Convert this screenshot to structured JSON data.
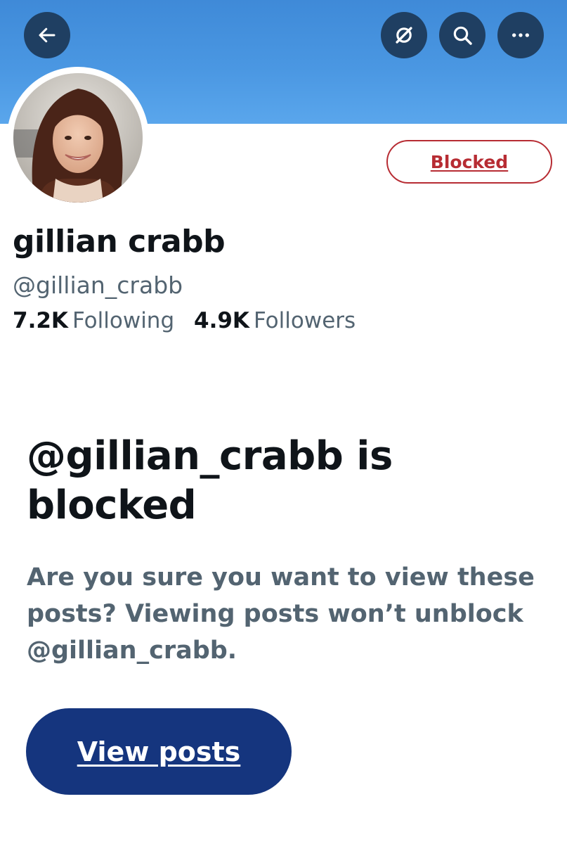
{
  "icons": {
    "back": "arrow-left-icon",
    "grok": "slashed-circle-icon",
    "search": "search-icon",
    "more": "more-horizontal-icon"
  },
  "colors": {
    "banner": "#4a97e2",
    "top_button": "#1f3f62",
    "blocked": "#b72c33",
    "primary_button": "#15357e",
    "secondary_text": "#536471"
  },
  "profile": {
    "display_name": "gillian crabb",
    "handle": "@gillian_crabb",
    "following_count": "7.2K",
    "following_label": "Following",
    "followers_count": "4.9K",
    "followers_label": "Followers",
    "blocked_button_label": "Blocked"
  },
  "blocked_notice": {
    "title": "@gillian_crabb is blocked",
    "description": "Are you sure you want to view these posts? Viewing posts won’t unblock @gillian_crabb.",
    "view_button_label": "View posts"
  }
}
